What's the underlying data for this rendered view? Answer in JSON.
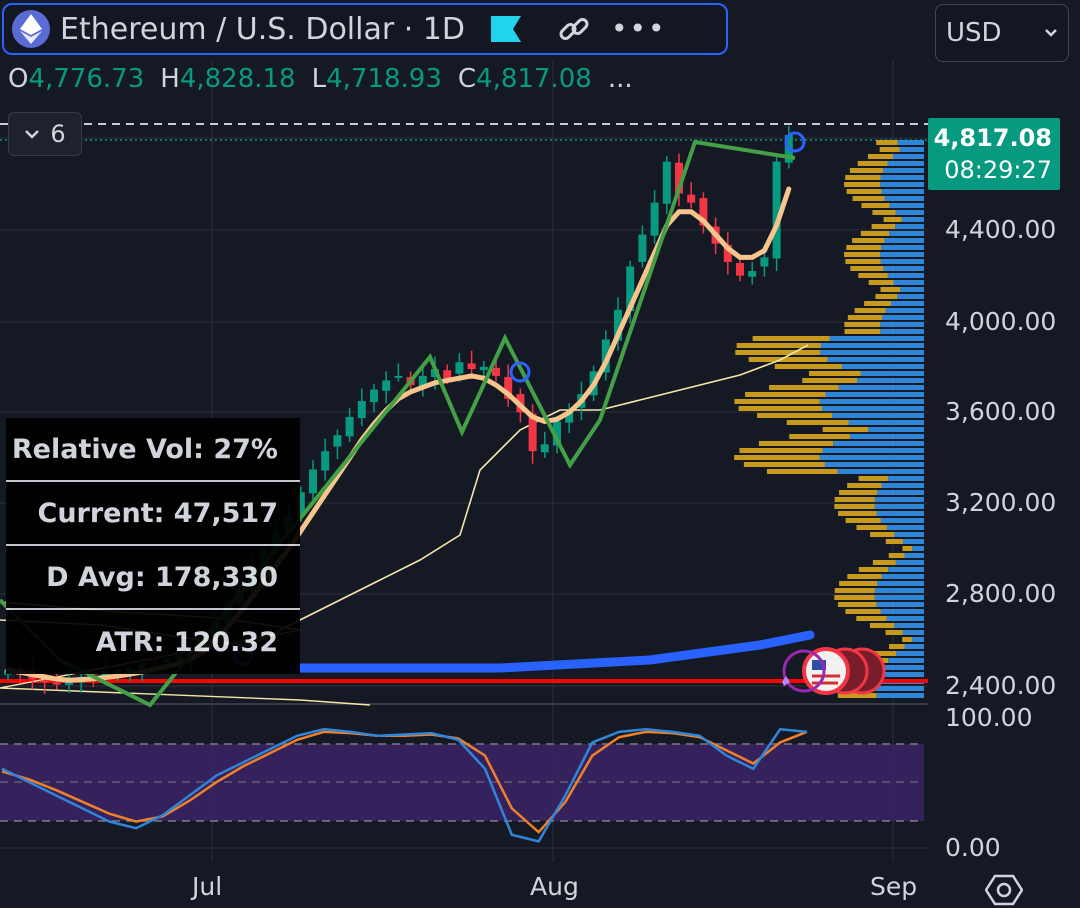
{
  "header": {
    "symbol_title": "Ethereum / U.S. Dollar · 1D",
    "currency": "USD",
    "more_label": "•••",
    "interval_collapse_count": "6"
  },
  "ohlc": {
    "open_label": "O",
    "open": "4,776.73",
    "high_label": "H",
    "high": "4,828.18",
    "low_label": "L",
    "low": "4,718.93",
    "close_label": "C",
    "close": "4,817.08",
    "more": "..."
  },
  "last_price": {
    "price": "4,817.08",
    "countdown": "08:29:27",
    "color": "#089981"
  },
  "stats_table": {
    "relative_vol": "Relative Vol: 27%",
    "current": "Current: 47,517",
    "d_avg": "D Avg: 178,330",
    "atr": "ATR: 120.32"
  },
  "price_axis": [
    "4,400.00",
    "4,000.00",
    "3,600.00",
    "3,200.00",
    "2,800.00",
    "2,400.00"
  ],
  "oscillator_axis": [
    "100.00",
    "0.00"
  ],
  "time_axis": [
    "Jul",
    "Aug",
    "Sep"
  ],
  "colors": {
    "background": "#151924",
    "up": "#089981",
    "down": "#f23645",
    "ma_orange": "#f7c58c",
    "zigzag_green": "#43a047",
    "vwap_line": "#f5e6a8",
    "ma_blue": "#2962ff",
    "red_level": "#ff0000",
    "rsi_fill": "#3b2566",
    "volume_profile_gold": "#c79a1d",
    "volume_profile_blue": "#2f86d8"
  },
  "chart_data": {
    "type": "candlestick",
    "title": "Ethereum / U.S. Dollar · 1D",
    "x_ticks": [
      "Jul",
      "Aug",
      "Sep"
    ],
    "y_ticks": [
      2400,
      2800,
      3200,
      3600,
      4000,
      4400
    ],
    "ylim": [
      2380,
      4900
    ],
    "last_close": 4817.08,
    "series": [
      {
        "name": "close",
        "values": [
          2470,
          2450,
          2430,
          2420,
          2410,
          2420,
          2440,
          2450,
          2460,
          2470,
          2480,
          2500,
          2510,
          2520,
          2530,
          2560,
          2600,
          2680,
          2760,
          2830,
          2920,
          3000,
          3080,
          3150,
          3250,
          3350,
          3430,
          3500,
          3580,
          3650,
          3700,
          3740,
          3760,
          3720,
          3760,
          3790,
          3750,
          3820,
          3790,
          3800,
          3760,
          3660,
          3600,
          3430,
          3460,
          3560,
          3600,
          3680,
          3780,
          3920,
          4050,
          4240,
          4380,
          4520,
          4700,
          4560,
          4520,
          4420,
          4340,
          4260,
          4200,
          4220,
          4280,
          4700,
          4817
        ]
      },
      {
        "name": "moving average",
        "values": [
          2470,
          2460,
          2450,
          2440,
          2430,
          2425,
          2428,
          2432,
          2438,
          2444,
          2452,
          2462,
          2474,
          2486,
          2500,
          2520,
          2550,
          2600,
          2660,
          2720,
          2790,
          2860,
          2930,
          3000,
          3080,
          3160,
          3240,
          3320,
          3400,
          3480,
          3550,
          3610,
          3660,
          3690,
          3710,
          3730,
          3740,
          3750,
          3760,
          3750,
          3720,
          3680,
          3630,
          3580,
          3560,
          3570,
          3600,
          3650,
          3720,
          3820,
          3940,
          4060,
          4180,
          4300,
          4420,
          4480,
          4480,
          4440,
          4380,
          4320,
          4280,
          4280,
          4310,
          4420,
          4580
        ]
      },
      {
        "name": "zigzag",
        "values": [
          2800,
          2400,
          2400,
          4000,
          3620,
          3900,
          3440,
          3500,
          4780,
          4760
        ]
      }
    ],
    "oscillator": {
      "ylim": [
        0,
        100
      ],
      "band": [
        20,
        80
      ],
      "fast": [
        60,
        50,
        40,
        30,
        20,
        15,
        25,
        40,
        55,
        65,
        75,
        85,
        90,
        88,
        85,
        86,
        87,
        82,
        60,
        10,
        5,
        40,
        80,
        88,
        90,
        88,
        85,
        70,
        60,
        90,
        88
      ],
      "slow": [
        58,
        52,
        44,
        35,
        26,
        20,
        24,
        36,
        50,
        62,
        72,
        82,
        88,
        87,
        85,
        85,
        86,
        83,
        70,
        30,
        12,
        35,
        70,
        84,
        88,
        87,
        84,
        74,
        64,
        80,
        88
      ]
    }
  }
}
